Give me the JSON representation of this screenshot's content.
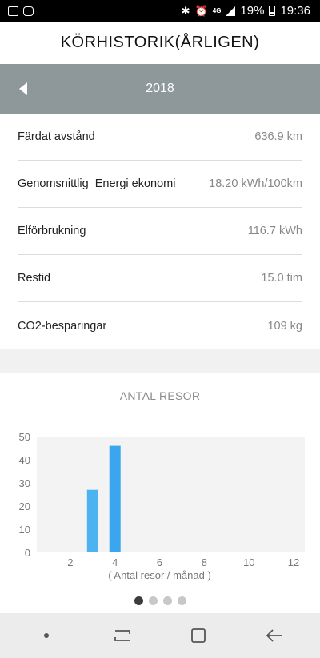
{
  "status_bar": {
    "battery": "19%",
    "time": "19:36",
    "network": "4G"
  },
  "header": {
    "title": "KÖRHISTORIK(ÅRLIGEN)"
  },
  "year_nav": {
    "year": "2018"
  },
  "stats": [
    {
      "label": "Färdat avstånd",
      "value": "636.9 km"
    },
    {
      "label": "Genomsnittlig  Energi ekonomi",
      "value": "18.20 kWh/100km"
    },
    {
      "label": "Elförbrukning",
      "value": "116.7 kWh"
    },
    {
      "label": "Restid",
      "value": "15.0 tim"
    },
    {
      "label": "CO2-besparingar",
      "value": "109 kg"
    }
  ],
  "chart": {
    "title": "ANTAL RESOR",
    "pages": 4,
    "active_page": 0
  },
  "chart_data": {
    "type": "bar",
    "title": "ANTAL RESOR",
    "xlabel": "( Antal resor / månad )",
    "ylabel": "",
    "x": [
      3,
      4
    ],
    "values": [
      27,
      46
    ],
    "xlim": [
      0.5,
      12.5
    ],
    "ylim": [
      0,
      50
    ],
    "x_ticks": [
      2,
      4,
      6,
      8,
      10,
      12
    ],
    "y_ticks": [
      0,
      10,
      20,
      30,
      40,
      50
    ],
    "colors": {
      "bar": "#4db2f0",
      "bar_highlight": "#39a6ee",
      "plot_bg": "#f3f3f3"
    }
  },
  "icons": {
    "back": "back-arrow-icon",
    "recent": "recent-apps-icon",
    "home": "home-icon",
    "year_prev": "triangle-left-icon"
  }
}
